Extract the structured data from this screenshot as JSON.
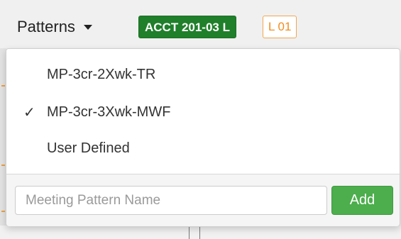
{
  "toolbar": {
    "patterns_label": "Patterns",
    "caret_icon": "caret-down-icon",
    "course_badge": "ACCT 201-03 L",
    "section_badge": "L 01"
  },
  "colors": {
    "course_badge_bg": "#1f7f2a",
    "section_badge_border": "#f1a64f",
    "section_badge_text": "#ef8e1f",
    "add_button_bg": "#4cae4c"
  },
  "menu": {
    "items": [
      {
        "label": "MP-3cr-2Xwk-TR",
        "selected": false
      },
      {
        "label": "MP-3cr-3Xwk-MWF",
        "selected": true,
        "check": "✓"
      },
      {
        "label": "User Defined",
        "selected": false
      }
    ],
    "check_icon": "checkmark-icon",
    "input": {
      "placeholder": "Meeting Pattern Name",
      "value": ""
    },
    "add_label": "Add"
  }
}
